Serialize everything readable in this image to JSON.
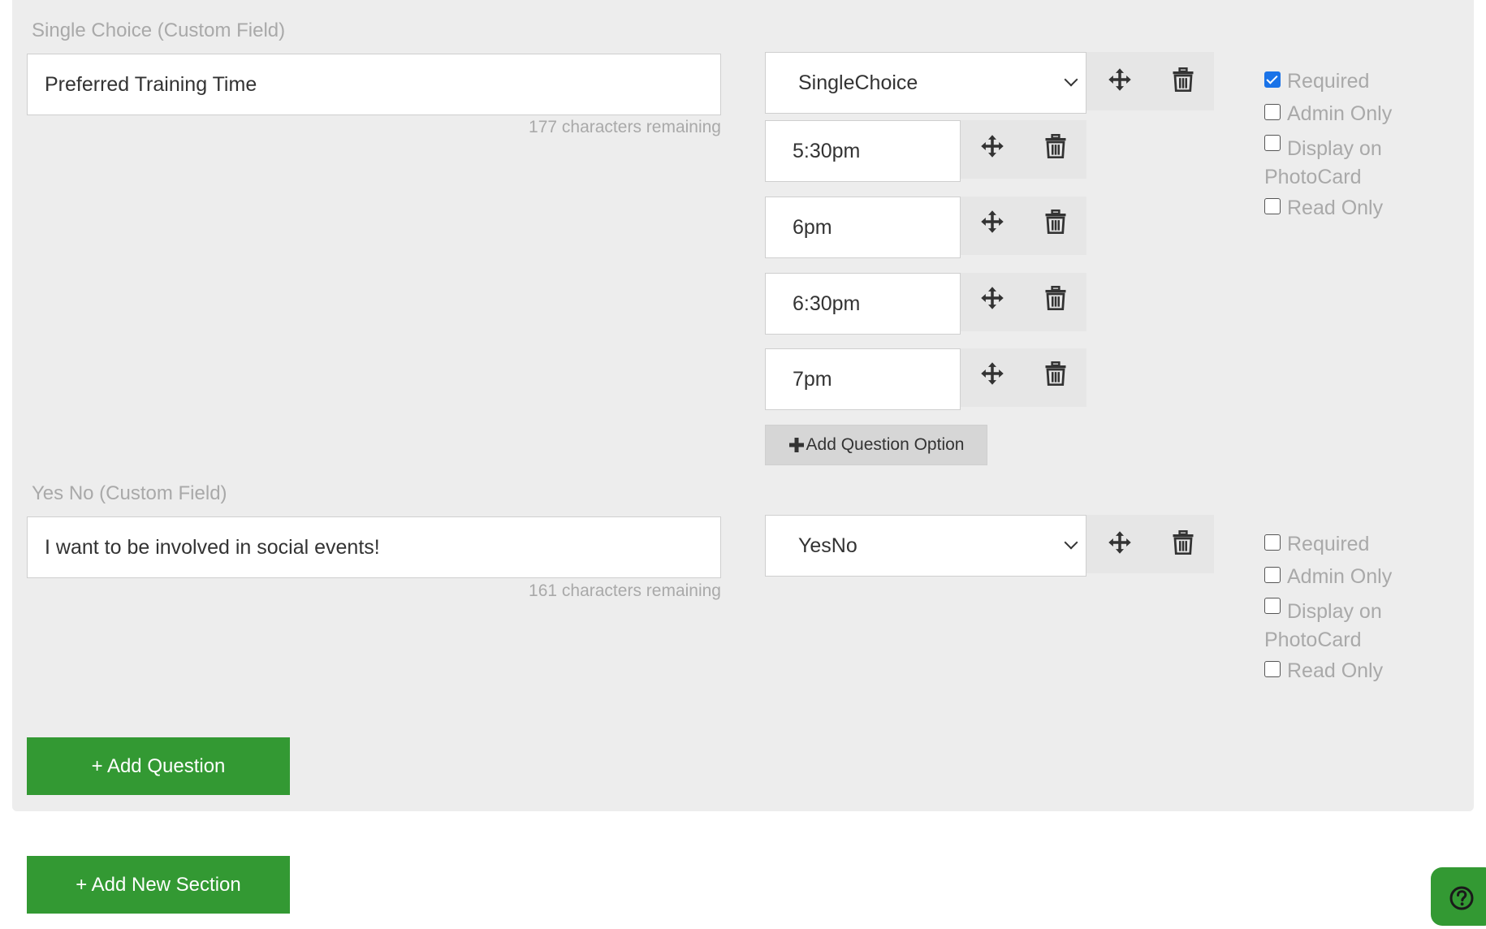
{
  "questions": [
    {
      "type_label": "Single Choice (Custom Field)",
      "text": "Preferred Training Time",
      "remaining": "177 characters remaining",
      "field_type": "SingleChoice",
      "options": [
        "5:30pm",
        "6pm",
        "6:30pm",
        "7pm"
      ],
      "add_option_label": "Add Question Option",
      "checkboxes": [
        {
          "label": "Required",
          "checked": true
        },
        {
          "label": "Admin Only",
          "checked": false
        },
        {
          "label": "Display on PhotoCard",
          "checked": false
        },
        {
          "label": "Read Only",
          "checked": false
        }
      ]
    },
    {
      "type_label": "Yes No (Custom Field)",
      "text": "I want to be involved in social events!",
      "remaining": "161 characters remaining",
      "field_type": "YesNo",
      "checkboxes": [
        {
          "label": "Required",
          "checked": false
        },
        {
          "label": "Admin Only",
          "checked": false
        },
        {
          "label": "Display on PhotoCard",
          "checked": false
        },
        {
          "label": "Read Only",
          "checked": false
        }
      ]
    }
  ],
  "buttons": {
    "add_question": "+ Add Question",
    "add_section": "+ Add New Section"
  },
  "colors": {
    "accent_green": "#339933",
    "panel_bg": "#ededed",
    "muted_text": "#a9a9a9"
  },
  "icons": {
    "move": "move-icon",
    "delete": "trash-icon",
    "add": "plus-icon",
    "help": "help-circle-icon"
  }
}
